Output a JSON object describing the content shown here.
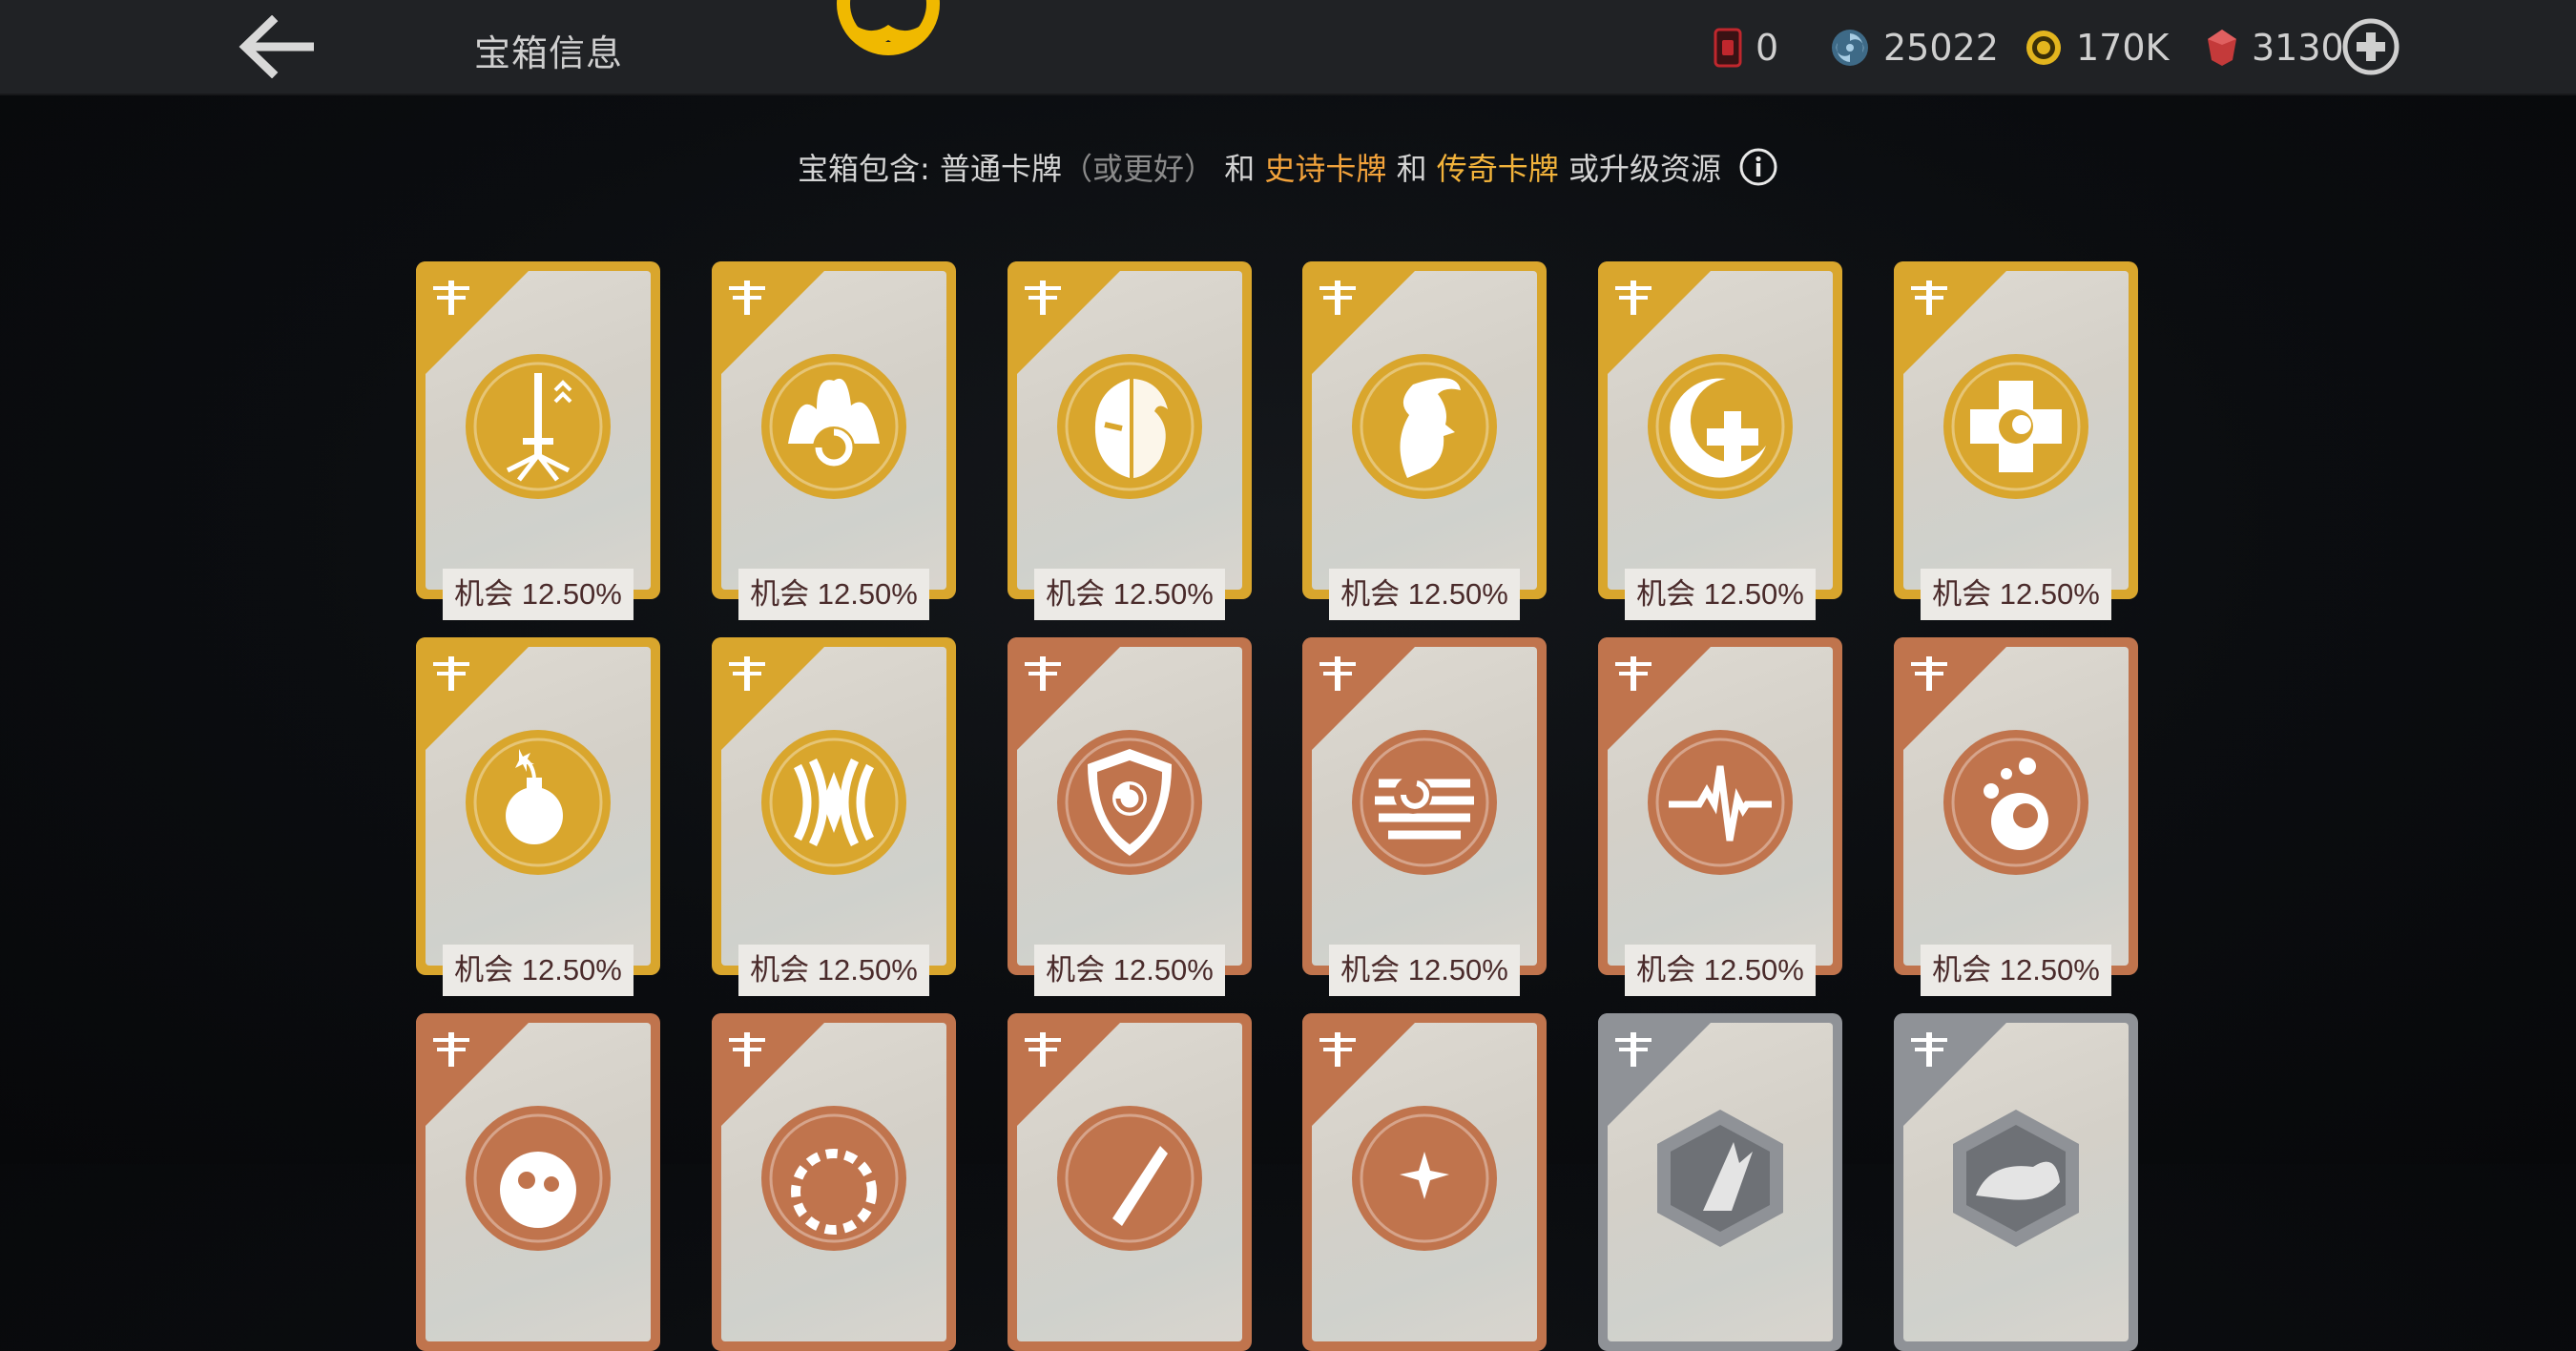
{
  "header": {
    "title": "宝箱信息"
  },
  "currencies": [
    {
      "name": "card-token",
      "value": "0",
      "color": "#c0272d"
    },
    {
      "name": "blue-orb",
      "value": "25022",
      "color": "#8fb7d2"
    },
    {
      "name": "gold-coin",
      "value": "170K",
      "color": "#e2b51e"
    },
    {
      "name": "red-gem",
      "value": "3130",
      "color": "#c43a3a"
    }
  ],
  "info": {
    "prefix": "宝箱包含: 普通卡牌",
    "muted": "（或更好）",
    "and1": " 和 ",
    "epic": "史诗卡牌",
    "and2": " 和 ",
    "legend": "传奇卡牌",
    "suffix": " 或升级资源"
  },
  "colors": {
    "gold": "#d9a62d",
    "bronze": "#c0744d",
    "silver": "#8f9297",
    "chance_text": "#4a2b2b"
  },
  "cards": [
    {
      "tier": "gold",
      "icon": "sword-icon",
      "chance": "机会 12.50%"
    },
    {
      "tier": "gold",
      "icon": "flame-swirl-icon",
      "chance": "机会 12.50%"
    },
    {
      "tier": "gold",
      "icon": "fire-mask-icon",
      "chance": "机会 12.50%"
    },
    {
      "tier": "gold",
      "icon": "spirit-face-icon",
      "chance": "机会 12.50%"
    },
    {
      "tier": "gold",
      "icon": "moon-cross-icon",
      "chance": "机会 12.50%"
    },
    {
      "tier": "gold",
      "icon": "medic-cross-icon",
      "chance": "机会 12.50%"
    },
    {
      "tier": "gold",
      "icon": "bomb-icon",
      "chance": "机会 12.50%"
    },
    {
      "tier": "gold",
      "icon": "sonic-wave-icon",
      "chance": "机会 12.50%"
    },
    {
      "tier": "bronze",
      "icon": "shield-swirl-icon",
      "chance": "机会 12.50%"
    },
    {
      "tier": "bronze",
      "icon": "striped-orb-icon",
      "chance": "机会 12.50%"
    },
    {
      "tier": "bronze",
      "icon": "heartbeat-icon",
      "chance": "机会 12.50%"
    },
    {
      "tier": "bronze",
      "icon": "splash-orb-icon",
      "chance": "机会 12.50%"
    },
    {
      "tier": "bronze",
      "icon": "spotted-ball-icon",
      "chance": ""
    },
    {
      "tier": "bronze",
      "icon": "gear-ring-icon",
      "chance": ""
    },
    {
      "tier": "bronze",
      "icon": "blade-icon",
      "chance": ""
    },
    {
      "tier": "bronze",
      "icon": "spark-icon",
      "chance": ""
    },
    {
      "tier": "silver",
      "icon": "hex-claw-icon",
      "chance": ""
    },
    {
      "tier": "silver",
      "icon": "hex-beast-icon",
      "chance": ""
    }
  ]
}
